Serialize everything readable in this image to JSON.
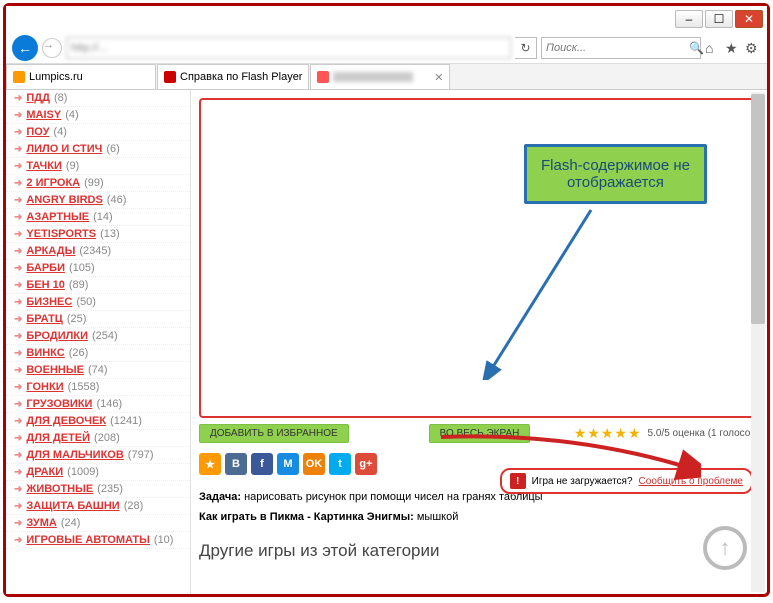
{
  "window": {
    "addressbar_text": "http://...",
    "search_placeholder": "Поиск...",
    "tabs": [
      {
        "label": "Lumpics.ru",
        "favicon_color": "#f90"
      },
      {
        "label": "Справка по Flash Player",
        "favicon_color": "#c00"
      },
      {
        "label": " ",
        "favicon_color": "#f55"
      }
    ]
  },
  "sidebar": {
    "items": [
      {
        "name": "ПДД",
        "count": "(8)"
      },
      {
        "name": "MAISY",
        "count": "(4)"
      },
      {
        "name": "ПОУ",
        "count": "(4)"
      },
      {
        "name": "ЛИЛО И СТИЧ",
        "count": "(6)"
      },
      {
        "name": "ТАЧКИ",
        "count": "(9)"
      },
      {
        "name": "2 ИГРОКА",
        "count": "(99)"
      },
      {
        "name": "ANGRY BIRDS",
        "count": "(46)"
      },
      {
        "name": "АЗАРТНЫЕ",
        "count": "(14)"
      },
      {
        "name": "YETISPORTS",
        "count": "(13)"
      },
      {
        "name": "АРКАДЫ",
        "count": "(2345)"
      },
      {
        "name": "БАРБИ",
        "count": "(105)"
      },
      {
        "name": "БЕН 10",
        "count": "(89)"
      },
      {
        "name": "БИЗНЕС",
        "count": "(50)"
      },
      {
        "name": "БРАТЦ",
        "count": "(25)"
      },
      {
        "name": "БРОДИЛКИ",
        "count": "(254)"
      },
      {
        "name": "ВИНКС",
        "count": "(26)"
      },
      {
        "name": "ВОЕННЫЕ",
        "count": "(74)"
      },
      {
        "name": "ГОНКИ",
        "count": "(1558)"
      },
      {
        "name": "ГРУЗОВИКИ",
        "count": "(146)"
      },
      {
        "name": "ДЛЯ ДЕВОЧЕК",
        "count": "(1241)"
      },
      {
        "name": "ДЛЯ ДЕТЕЙ",
        "count": "(208)"
      },
      {
        "name": "ДЛЯ МАЛЬЧИКОВ",
        "count": "(797)"
      },
      {
        "name": "ДРАКИ",
        "count": "(1009)"
      },
      {
        "name": "ЖИВОТНЫЕ",
        "count": "(235)"
      },
      {
        "name": "ЗАЩИТА БАШНИ",
        "count": "(28)"
      },
      {
        "name": "ЗУМА",
        "count": "(24)"
      },
      {
        "name": "ИГРОВЫЕ АВТОМАТЫ",
        "count": "(10)"
      }
    ]
  },
  "main": {
    "callout_line1": "Flash-содержимое не",
    "callout_line2": "отображается",
    "fav_btn": "ДОБАВИТЬ В ИЗБРАННОЕ",
    "full_btn": "ВО ВЕСЬ ЭКРАН",
    "rating_text": "5.0/5 оценка (1 голосов)",
    "error_q": "Игра не загружается?",
    "error_link": "Сообщить о проблеме",
    "task_label": "Задача:",
    "task_text": " нарисовать рисунок при помощи чисел на гранях таблицы",
    "howto_label": "Как играть в Пикма - Картинка Энигмы:",
    "howto_text": " мышкой",
    "section_heading": "Другие игры из этой категории"
  },
  "social": [
    {
      "bg": "#f90",
      "t": "★"
    },
    {
      "bg": "#4c6c91",
      "t": "B"
    },
    {
      "bg": "#3b5998",
      "t": "f"
    },
    {
      "bg": "#168de2",
      "t": "M"
    },
    {
      "bg": "#ee8208",
      "t": "OK"
    },
    {
      "bg": "#00aced",
      "t": "t"
    },
    {
      "bg": "#dd4b39",
      "t": "g+"
    }
  ]
}
